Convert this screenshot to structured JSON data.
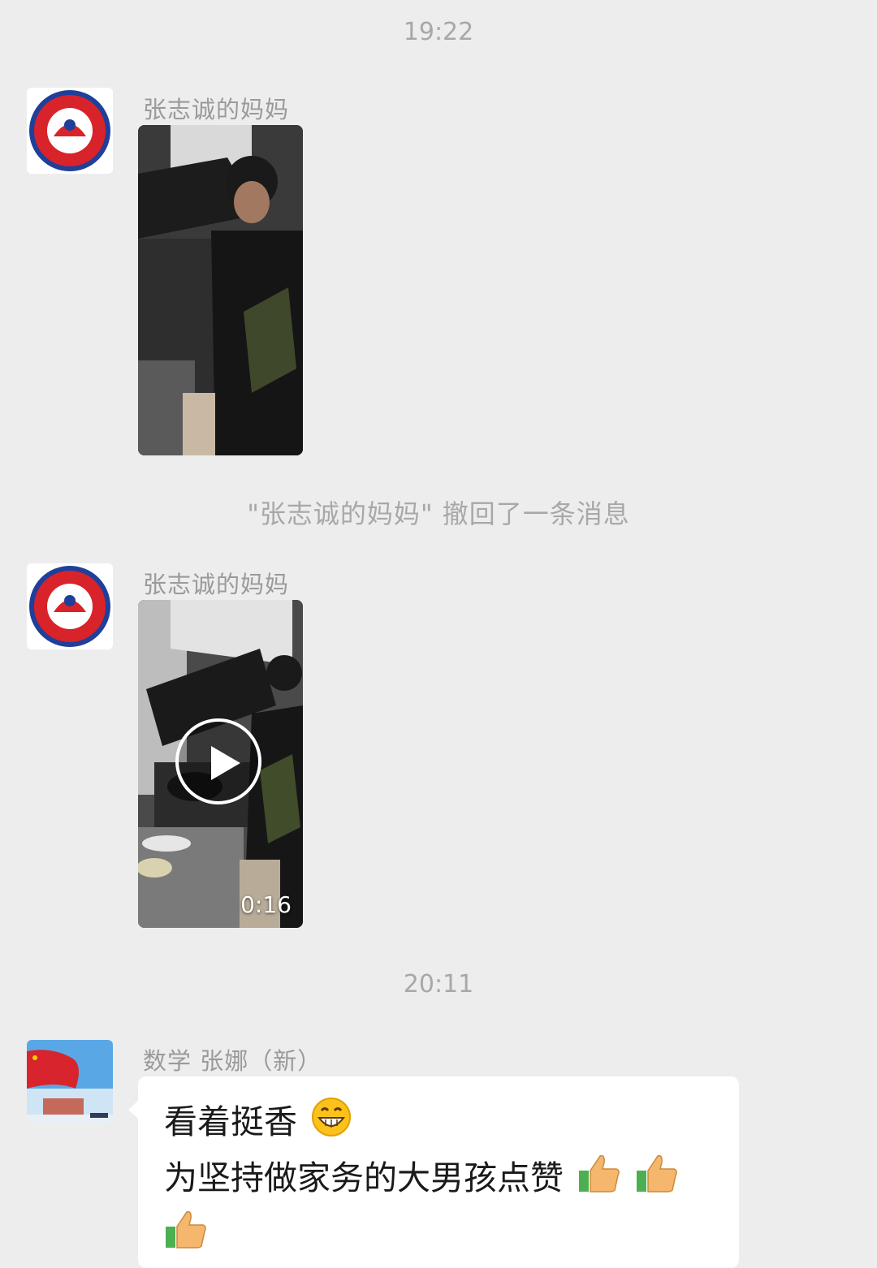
{
  "chat": {
    "timestamp_1": "19:22",
    "timestamp_2": "20:11",
    "recall_notice": "\"张志诚的妈妈\" 撤回了一条消息",
    "messages": [
      {
        "sender": "张志诚的妈妈",
        "type": "image",
        "avatar": "kindergarten-logo"
      },
      {
        "sender": "张志诚的妈妈",
        "type": "video",
        "duration": "0:16",
        "avatar": "kindergarten-logo"
      },
      {
        "sender": "数学 张娜（新）",
        "type": "text",
        "avatar": "flag-photo",
        "line_1": "看着挺香",
        "line_2": "为坚持做家务的大男孩点赞",
        "emojis": [
          "grin-emoji",
          "thumbs-up-emoji",
          "thumbs-up-emoji",
          "thumbs-up-emoji"
        ]
      }
    ]
  },
  "colors": {
    "background": "#ededed",
    "bubble": "#ffffff",
    "meta_text": "#a8a8a8"
  }
}
